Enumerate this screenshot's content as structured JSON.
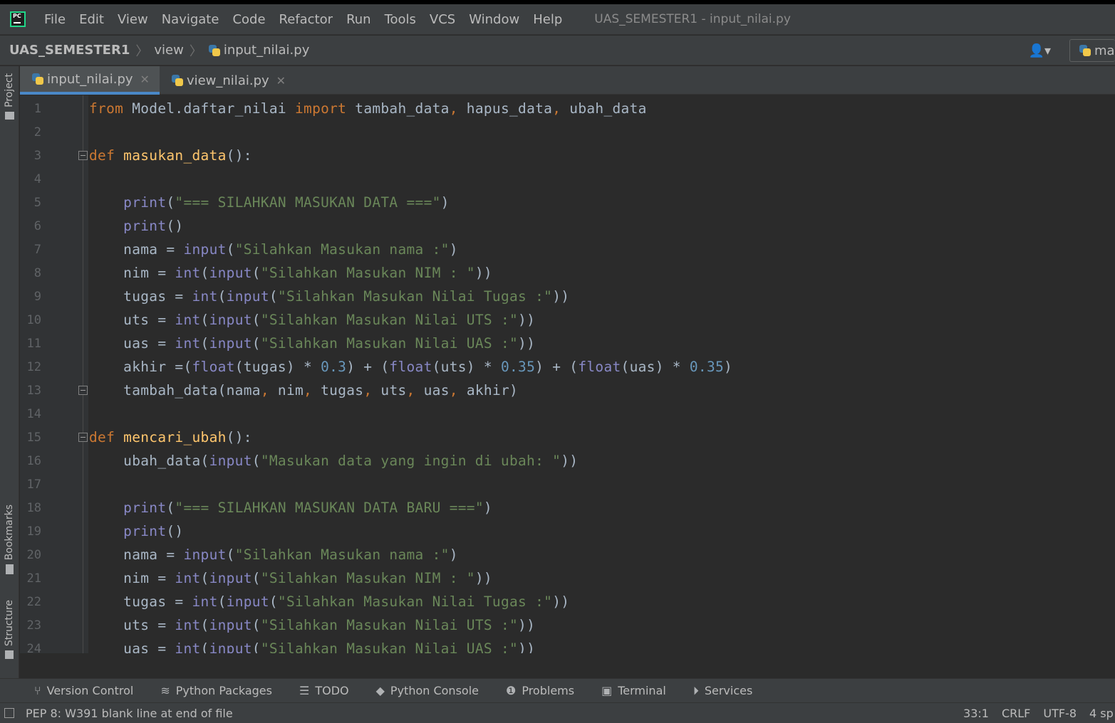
{
  "menubar": {
    "items": [
      "File",
      "Edit",
      "View",
      "Navigate",
      "Code",
      "Refactor",
      "Run",
      "Tools",
      "VCS",
      "Window",
      "Help"
    ],
    "title": "UAS_SEMESTER1 - input_nilai.py"
  },
  "navbar": {
    "project": "UAS_SEMESTER1",
    "folder": "view",
    "file": "input_nilai.py",
    "run_config": "ma"
  },
  "left_tabs": {
    "project": "Project",
    "bookmarks": "Bookmarks",
    "structure": "Structure"
  },
  "tabs": [
    {
      "label": "input_nilai.py",
      "active": true
    },
    {
      "label": "view_nilai.py",
      "active": false
    }
  ],
  "editor": {
    "line_numbers": [
      "1",
      "2",
      "3",
      "4",
      "5",
      "6",
      "7",
      "8",
      "9",
      "10",
      "11",
      "12",
      "13",
      "14",
      "15",
      "16",
      "17",
      "18",
      "19",
      "20",
      "21",
      "22",
      "23",
      "24"
    ],
    "lines": [
      "from Model.daftar_nilai import tambah_data, hapus_data, ubah_data",
      "",
      "def masukan_data():",
      "",
      "    print(\"=== SILAHKAN MASUKAN DATA ===\")",
      "    print()",
      "    nama = input(\"Silahkan Masukan nama :\")",
      "    nim = int(input(\"Silahkan Masukan NIM : \"))",
      "    tugas = int(input(\"Silahkan Masukan Nilai Tugas :\"))",
      "    uts = int(input(\"Silahkan Masukan Nilai UTS :\"))",
      "    uas = int(input(\"Silahkan Masukan Nilai UAS :\"))",
      "    akhir =(float(tugas) * 0.3) + (float(uts) * 0.35) + (float(uas) * 0.35)",
      "    tambah_data(nama, nim, tugas, uts, uas, akhir)",
      "",
      "def mencari_ubah():",
      "    ubah_data(input(\"Masukan data yang ingin di ubah: \"))",
      "",
      "    print(\"=== SILAHKAN MASUKAN DATA BARU ===\")",
      "    print()",
      "    nama = input(\"Silahkan Masukan nama :\")",
      "    nim = int(input(\"Silahkan Masukan NIM : \"))",
      "    tugas = int(input(\"Silahkan Masukan Nilai Tugas :\"))",
      "    uts = int(input(\"Silahkan Masukan Nilai UTS :\"))",
      "    uas = int(input(\"Silahkan Masukan Nilai UAS :\"))"
    ]
  },
  "tool_windows": [
    {
      "label": "Version Control",
      "icon": "branch-icon"
    },
    {
      "label": "Python Packages",
      "icon": "layers-icon"
    },
    {
      "label": "TODO",
      "icon": "list-icon"
    },
    {
      "label": "Python Console",
      "icon": "python-icon"
    },
    {
      "label": "Problems",
      "icon": "exclamation-icon"
    },
    {
      "label": "Terminal",
      "icon": "terminal-icon"
    },
    {
      "label": "Services",
      "icon": "services-icon"
    }
  ],
  "status": {
    "message": "PEP 8: W391 blank line at end of file",
    "position": "33:1",
    "line_sep": "CRLF",
    "encoding": "UTF-8",
    "indent": "4 sp"
  },
  "colors": {
    "keyword": "#cc7832",
    "function_def": "#ffc66d",
    "builtin": "#8888c6",
    "string": "#6a8759",
    "number": "#6897bb",
    "accent": "#4a88c7"
  }
}
